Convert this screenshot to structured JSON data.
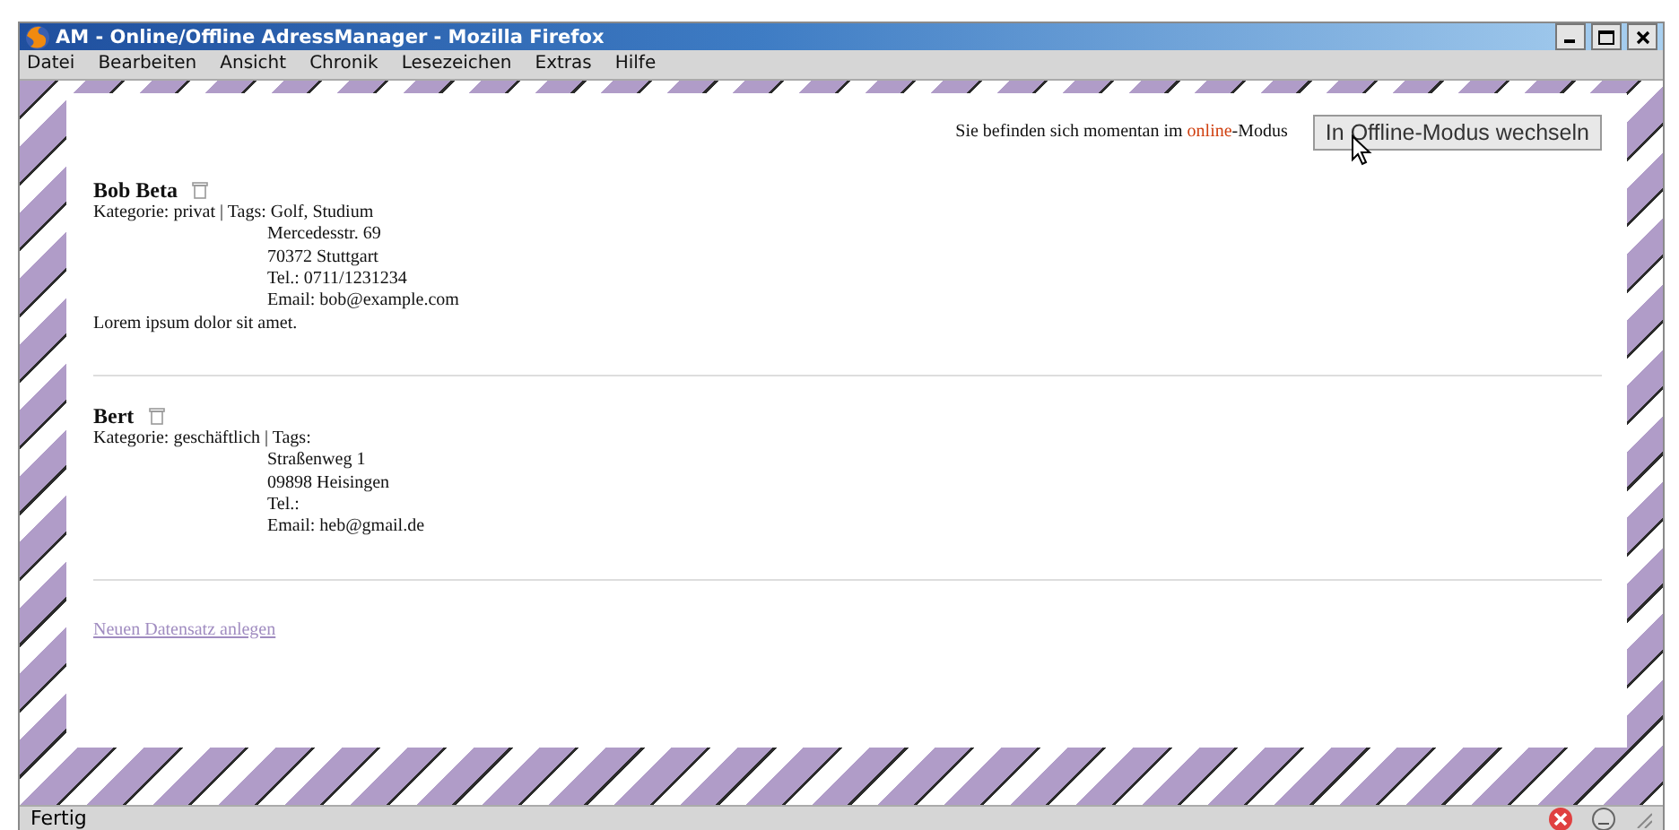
{
  "window": {
    "title": "AM - Online/Offline AdressManager - Mozilla Firefox"
  },
  "menu": [
    "Datei",
    "Bearbeiten",
    "Ansicht",
    "Chronik",
    "Lesezeichen",
    "Extras",
    "Hilfe"
  ],
  "mode_status": {
    "prefix": "Sie befinden sich momentan im",
    "mode": "online",
    "suffix": "-Modus",
    "button": "In Offline-Modus wechseln"
  },
  "contacts": [
    {
      "name": "Bob Beta",
      "meta": "Kategorie: privat | Tags: Golf, Studium",
      "address": [
        "Mercedesstr. 69",
        "70372 Stuttgart",
        "Tel.: 0711/1231234",
        "Email: bob@example.com"
      ],
      "note": "Lorem ipsum dolor sit amet."
    },
    {
      "name": "Bert",
      "meta": "Kategorie: geschäftlich | Tags:",
      "address": [
        "Straßenweg 1",
        "09898 Heisingen",
        "Tel.:",
        "Email: heb@gmail.de"
      ]
    }
  ],
  "new_record_link": "Neuen Datensatz anlegen",
  "status_bar": {
    "text": "Fertig"
  }
}
